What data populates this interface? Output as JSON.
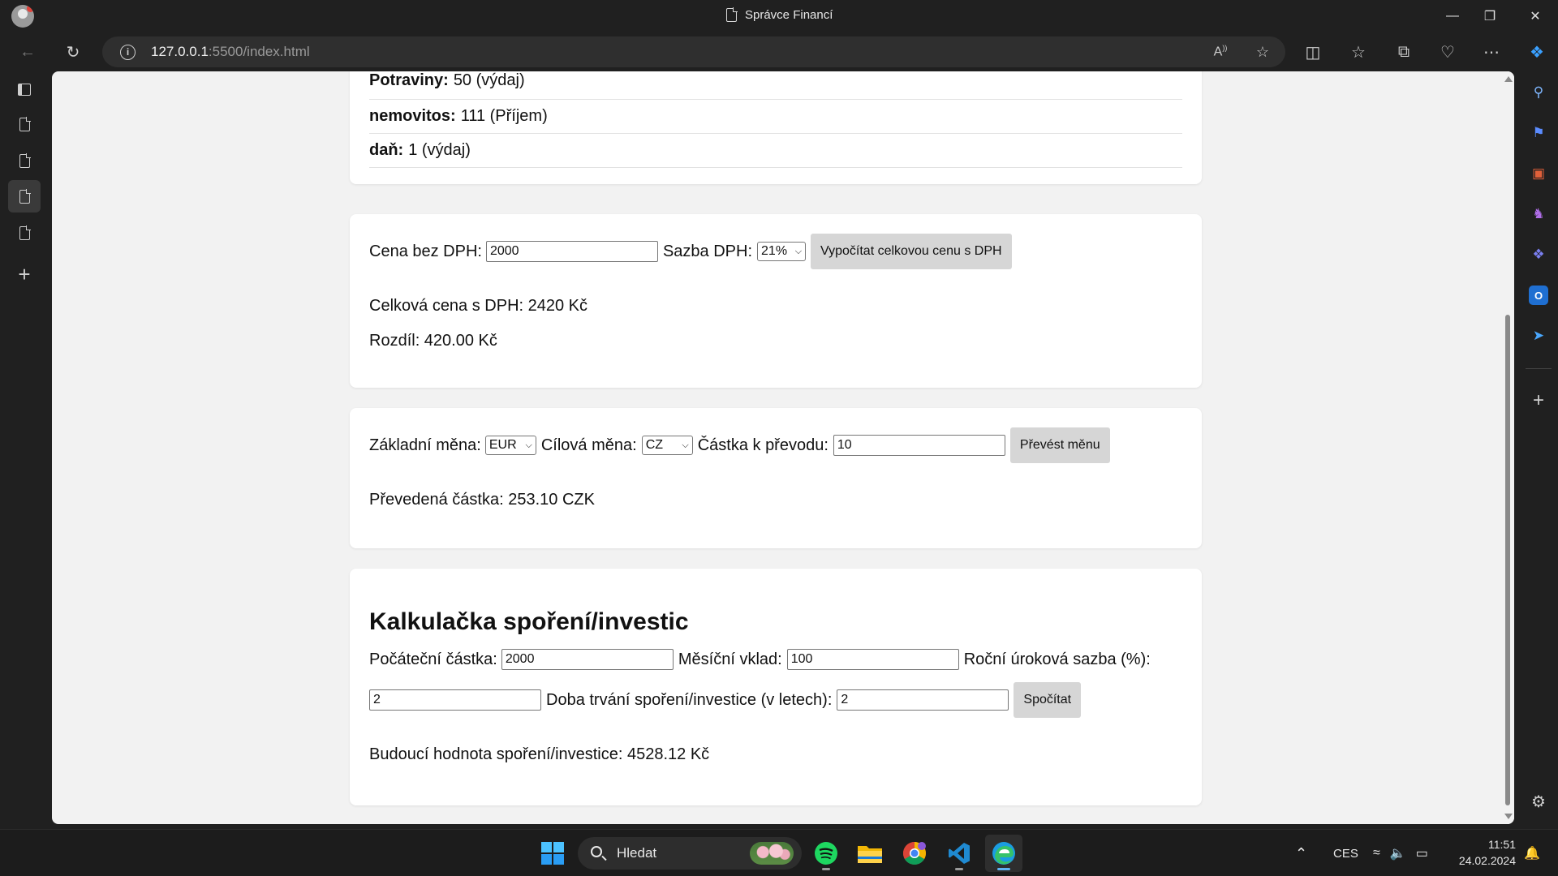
{
  "window": {
    "title": "Správce Financí",
    "controls": [
      "minimize-icon",
      "restore-icon",
      "close-icon"
    ]
  },
  "browser": {
    "url_host": "127.0.0.1",
    "url_path": ":5500/index.html"
  },
  "page": {
    "transactions": [
      {
        "name": "Potraviny:",
        "amount": "50 (výdaj)"
      },
      {
        "name": "nemovitos:",
        "amount": "111 (Příjem)"
      },
      {
        "name": "daň:",
        "amount": "1 (výdaj)"
      }
    ],
    "vat": {
      "price_label": "Cena bez DPH:",
      "price_value": "2000",
      "rate_label": "Sazba DPH:",
      "rate_selected": "21%",
      "button": "Vypočítat celkovou cenu s DPH",
      "total": "Celková cena s DPH: 2420 Kč",
      "difference": "Rozdíl: 420.00 Kč"
    },
    "currency": {
      "base_label": "Základní měna:",
      "base_selected": "EUR",
      "target_label": "Cílová měna:",
      "target_selected": "CZ",
      "amount_label": "Částka k převodu:",
      "amount_value": "10",
      "button": "Převést měnu",
      "result": "Převedená částka: 253.10 CZK"
    },
    "savings": {
      "heading": "Kalkulačka spoření/investic",
      "initial_label": "Počáteční částka:",
      "initial_value": "2000",
      "monthly_label": "Měsíční vklad:",
      "monthly_value": "100",
      "rate_label": "Roční úroková sazba (%):",
      "rate_value": "2",
      "duration_label": "Doba trvání spoření/investice (v letech):",
      "duration_value": "2",
      "button": "Spočítat",
      "result": "Budoucí hodnota spoření/investice: 4528.12 Kč"
    }
  },
  "taskbar": {
    "search_placeholder": "Hledat",
    "language": "CES",
    "time": "11:51",
    "date": "24.02.2024"
  },
  "colors": {
    "browser_bg": "#202020",
    "page_bg": "#f2f2f2",
    "card_bg": "#ffffff",
    "button_bg": "#d6d6d6",
    "active_indicator": "#5fb2f2"
  }
}
